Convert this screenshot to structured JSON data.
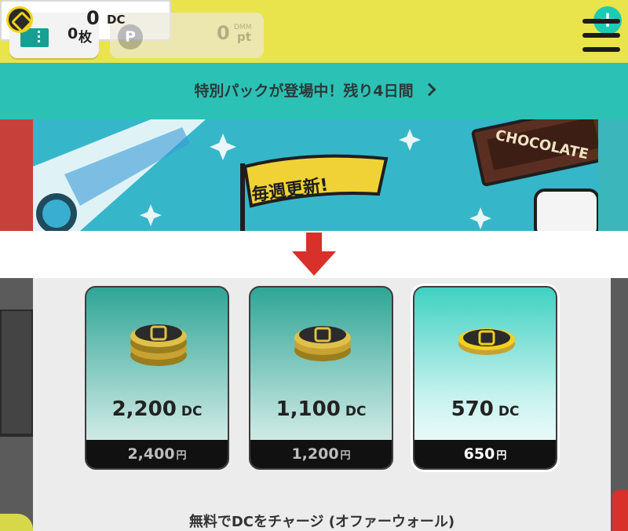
{
  "header": {
    "tickets": {
      "count": "0",
      "unit": "枚"
    },
    "points": {
      "value": "0",
      "label_top": "DMM",
      "label_bottom": "pt"
    },
    "dc": {
      "value": "0",
      "unit": "DC"
    }
  },
  "announcement": {
    "text": "特別パックが登場中！残り4日間"
  },
  "banner": {
    "flag_text": "毎週更新!",
    "chocolate_text": "CHOCOLATE"
  },
  "packs": [
    {
      "amount": "2,200",
      "unit": "DC",
      "price": "2,400",
      "currency": "円",
      "selected": false
    },
    {
      "amount": "1,100",
      "unit": "DC",
      "price": "1,200",
      "currency": "円",
      "selected": false
    },
    {
      "amount": "570",
      "unit": "DC",
      "price": "650",
      "currency": "円",
      "selected": true
    }
  ],
  "offerwall": {
    "label": "無料でDCをチャージ (オファーウォール)"
  },
  "colors": {
    "header": "#e9e44c",
    "accent": "#1ccbb4",
    "arrow": "#d8302a",
    "coin": "#e6c23a"
  }
}
